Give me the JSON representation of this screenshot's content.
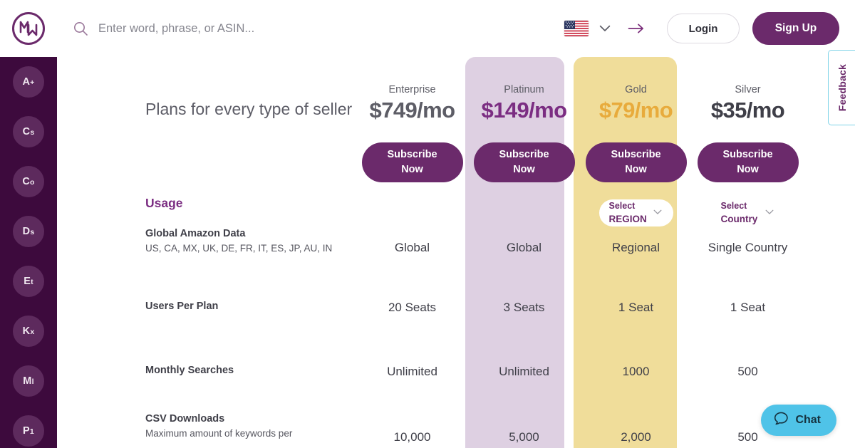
{
  "header": {
    "logo_name": "mw-logo",
    "search": {
      "placeholder": "Enter word, phrase, or ASIN...",
      "value": ""
    },
    "locale_flag": "us-flag",
    "login_label": "Login",
    "signup_label": "Sign Up"
  },
  "sidebar": {
    "items": [
      {
        "label": "A",
        "sub": "+",
        "name": "sidebar-item-a-plus"
      },
      {
        "label": "C",
        "sub": "s",
        "name": "sidebar-item-cs"
      },
      {
        "label": "C",
        "sub": "o",
        "name": "sidebar-item-co"
      },
      {
        "label": "D",
        "sub": "s",
        "name": "sidebar-item-ds"
      },
      {
        "label": "E",
        "sub": "t",
        "name": "sidebar-item-et"
      },
      {
        "label": "K",
        "sub": "x",
        "name": "sidebar-item-kx"
      },
      {
        "label": "M",
        "sub": "l",
        "name": "sidebar-item-ml"
      },
      {
        "label": "P",
        "sub": "1",
        "name": "sidebar-item-p1"
      }
    ]
  },
  "main": {
    "title": "Plans for every type of seller",
    "section_heading": "Usage",
    "plans": [
      {
        "name": "Enterprise",
        "price": "$749/mo",
        "price_color": "#5d5d66",
        "cta": {
          "line1": "Subscribe",
          "line2": "Now"
        },
        "selector": null
      },
      {
        "name": "Platinum",
        "price": "$149/mo",
        "price_color": "#7b2d82",
        "cta": {
          "line1": "Subscribe",
          "line2": "Now"
        },
        "selector": null
      },
      {
        "name": "Gold",
        "price": "$79/mo",
        "price_color": "#e8ab3c",
        "cta": {
          "line1": "Subscribe",
          "line2": "Now"
        },
        "selector": {
          "line1": "Select",
          "line2": "REGION"
        }
      },
      {
        "name": "Silver",
        "price": "$35/mo",
        "price_color": "#3f3f48",
        "cta": {
          "line1": "Subscribe",
          "line2": "Now"
        },
        "selector": {
          "line1": "Select",
          "line2": "Country"
        }
      }
    ],
    "features": [
      {
        "name": "Global Amazon Data",
        "sub": "US, CA, MX, UK, DE, FR, IT, ES, JP, AU, IN",
        "values": [
          "Global",
          "Global",
          "Regional",
          "Single Country"
        ]
      },
      {
        "name": "Users Per Plan",
        "sub": "",
        "values": [
          "20 Seats",
          "3 Seats",
          "1 Seat",
          "1 Seat"
        ]
      },
      {
        "name": "Monthly Searches",
        "sub": "",
        "values": [
          "Unlimited",
          "Unlimited",
          "1000",
          "500"
        ]
      },
      {
        "name": "CSV Downloads",
        "sub": "Maximum amount of keywords per",
        "values": [
          "10,000",
          "5,000",
          "2,000",
          "500"
        ]
      }
    ]
  },
  "feedback": {
    "label": "Feedback"
  },
  "chat": {
    "label": "Chat"
  },
  "colors": {
    "brand_purple": "#6b2a6b",
    "sidebar_purple": "#3d0a3d",
    "platinum_band": "#ded0e2",
    "gold_band": "#f0dd9a",
    "chat_blue": "#4fc3e8",
    "feedback_border": "#7fd3e8"
  }
}
